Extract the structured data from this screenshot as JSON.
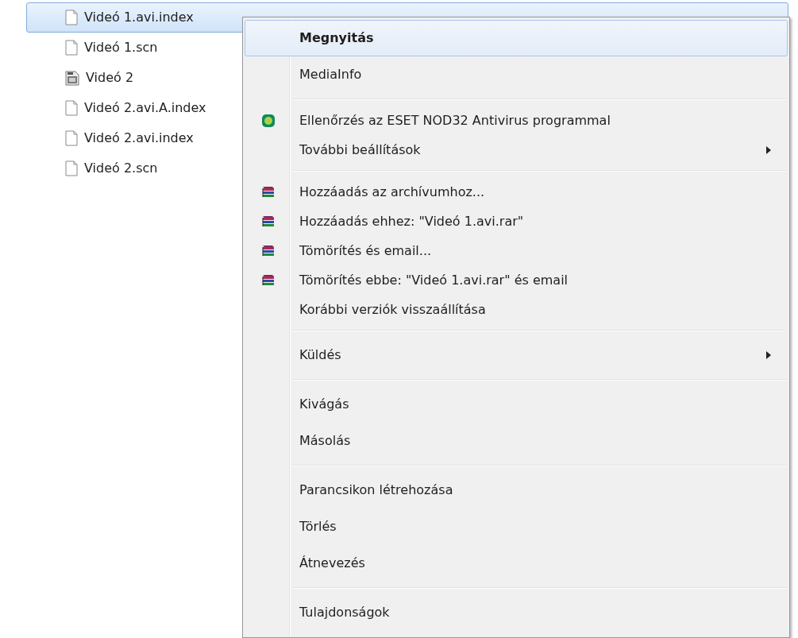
{
  "files": [
    {
      "name": "Videó 1.avi.index",
      "kind": "document",
      "selected": true
    },
    {
      "name": "Videó 1.scn",
      "kind": "document",
      "selected": false
    },
    {
      "name": "Videó 2",
      "kind": "video",
      "selected": false
    },
    {
      "name": "Videó 2.avi.A.index",
      "kind": "document",
      "selected": false
    },
    {
      "name": "Videó 2.avi.index",
      "kind": "document",
      "selected": false
    },
    {
      "name": "Videó 2.scn",
      "kind": "document",
      "selected": false
    }
  ],
  "context_menu": {
    "sections": [
      {
        "items": [
          {
            "label": "Megnyitás",
            "default": true,
            "selected": true
          },
          {
            "label": "MediaInfo",
            "selected": false
          }
        ]
      },
      {
        "items": [
          {
            "label": "Ellenőrzés az ESET NOD32 Antivirus programmal",
            "kind": "antivirus",
            "selected": false
          },
          {
            "label": "További beállítások",
            "submenu": true,
            "selected": false
          }
        ]
      },
      {
        "items": [
          {
            "label": "Hozzáadás az archívumhoz...",
            "kind": "archive",
            "selected": false
          },
          {
            "label": "Hozzáadás ehhez: \"Videó 1.avi.rar\"",
            "kind": "archive",
            "selected": false
          },
          {
            "label": "Tömörítés és email...",
            "kind": "archive",
            "selected": false
          },
          {
            "label": "Tömörítés ebbe: \"Videó 1.avi.rar\" és email",
            "kind": "archive",
            "selected": false
          },
          {
            "label": "Korábbi verziók visszaállítása",
            "selected": false
          }
        ]
      },
      {
        "items": [
          {
            "label": "Küldés",
            "submenu": true,
            "selected": false
          }
        ]
      },
      {
        "items": [
          {
            "label": "Kivágás",
            "selected": false
          },
          {
            "label": "Másolás",
            "selected": false
          }
        ]
      },
      {
        "items": [
          {
            "label": "Parancsikon létrehozása",
            "selected": false
          },
          {
            "label": "Törlés",
            "selected": false
          },
          {
            "label": "Átnevezés",
            "selected": false
          }
        ]
      },
      {
        "items": [
          {
            "label": "Tulajdonságok",
            "selected": false
          }
        ]
      }
    ]
  }
}
